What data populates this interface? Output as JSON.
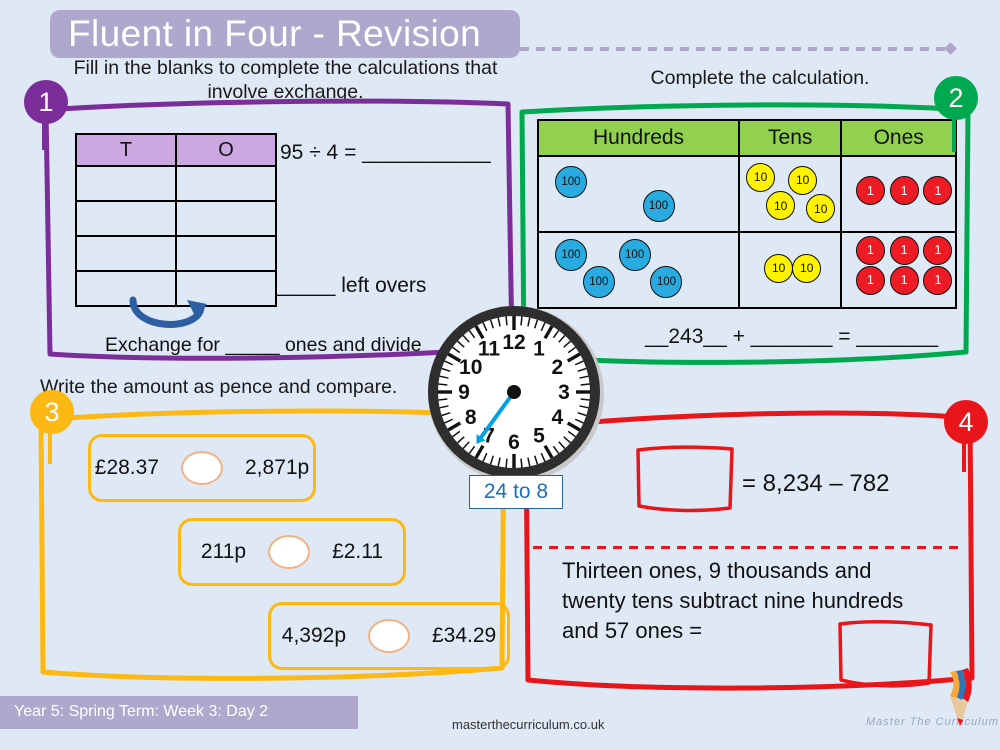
{
  "header": {
    "title": "Fluent in Four - Revision"
  },
  "sections": {
    "one": {
      "badge": "1",
      "badge_color": "#7b2d99",
      "prompt": "Fill in the blanks to complete the calculations that involve exchange.",
      "table_headers": [
        "T",
        "O"
      ],
      "table_rows": [
        [
          "",
          ""
        ],
        [
          "",
          ""
        ],
        [
          "",
          ""
        ],
        [
          "",
          ""
        ]
      ],
      "calculation": "95 ÷ 4 = ___________",
      "leftovers": "_____ left overs",
      "exchange_text": "Exchange for _____ ones and divide",
      "arrow_icon": "curved-exchange-arrow"
    },
    "two": {
      "badge": "2",
      "badge_color": "#00a94f",
      "prompt": "Complete the calculation.",
      "columns": [
        "Hundreds",
        "Tens",
        "Ones"
      ],
      "rows": [
        {
          "hundreds": 2,
          "tens": 4,
          "ones": 3
        },
        {
          "hundreds": 4,
          "tens": 2,
          "ones": 6
        }
      ],
      "counter_labels": {
        "hundreds": "100",
        "tens": "10",
        "ones": "1"
      },
      "counter_colors": {
        "hundreds": "#29abe2",
        "tens": "#fff200",
        "ones": "#ed1c24"
      },
      "equation": "__243__ + _______ = _______"
    },
    "three": {
      "badge": "3",
      "badge_color": "#fdb913",
      "prompt": "Write the amount as pence and compare.",
      "comparisons": [
        {
          "left": "£28.37",
          "right": "2,871p"
        },
        {
          "left": "211p",
          "right": "£2.11"
        },
        {
          "left": "4,392p",
          "right": "£34.29"
        }
      ]
    },
    "four": {
      "badge": "4",
      "badge_color": "#e8161a",
      "equation": "= 8,234 – 782",
      "word_problem": "Thirteen ones, 9 thousands and twenty tens subtract nine hundreds and 57 ones ="
    }
  },
  "clock": {
    "numerals": [
      "12",
      "1",
      "2",
      "3",
      "4",
      "5",
      "6",
      "7",
      "8",
      "9",
      "10",
      "11"
    ],
    "minute_hand_value": 36,
    "hand_color": "#00a0e3",
    "label": "24 to 8"
  },
  "footer": {
    "lesson": "Year 5: Spring Term: Week 3: Day 2",
    "website": "masterthecurriculum.co.uk",
    "brand": "Master The Curriculum"
  }
}
